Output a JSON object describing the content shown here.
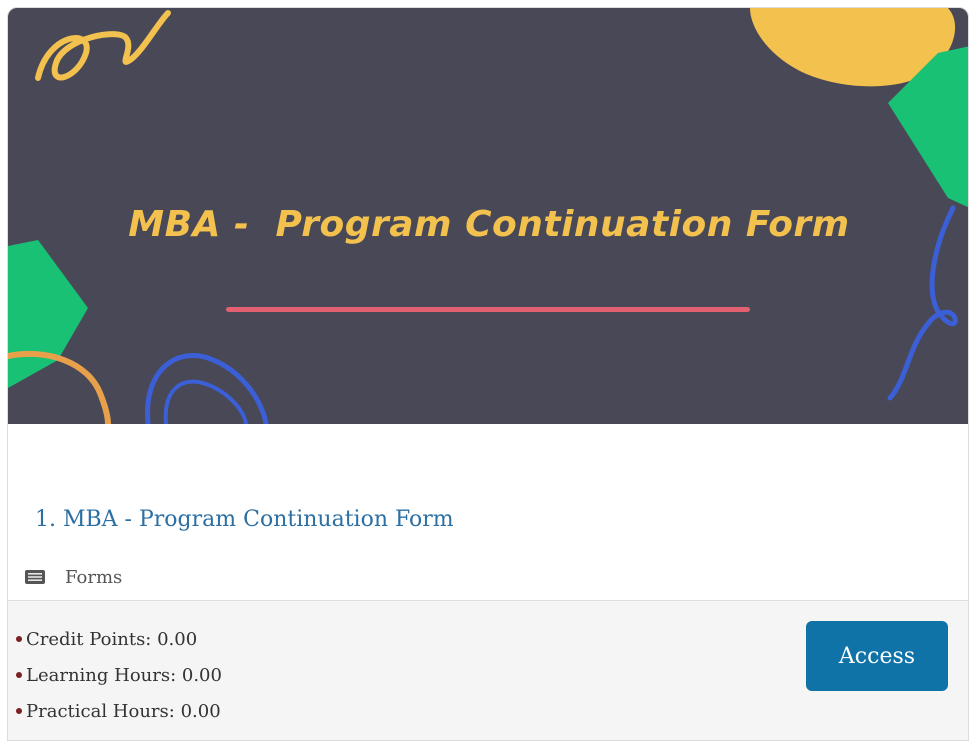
{
  "banner": {
    "title": "MBA -  Program Continuation Form",
    "colors": {
      "background": "#494857",
      "title": "#f2c14e",
      "underline": "#e2606f",
      "yellow": "#f2c14e",
      "green": "#19c174",
      "blue": "#3b5fd6",
      "orange": "#e8a14a"
    }
  },
  "course": {
    "title": "1. MBA - Program Continuation Form",
    "type_icon": "forms-icon",
    "type_label": "Forms"
  },
  "stats": [
    {
      "text": "Credit Points: 0.00"
    },
    {
      "text": "Learning Hours: 0.00"
    },
    {
      "text": "Practical Hours: 0.00"
    }
  ],
  "actions": {
    "access_label": "Access",
    "access_color": "#0f73a8"
  }
}
